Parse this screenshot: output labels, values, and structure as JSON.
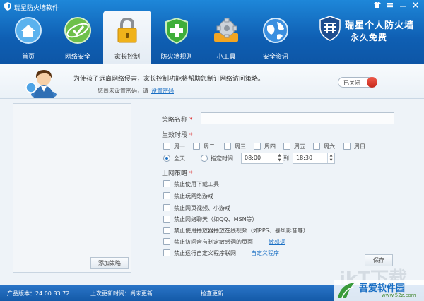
{
  "window": {
    "title": "瑞星防火墙软件"
  },
  "brand": {
    "line1": "瑞星个人防火墙",
    "line2": "永久免费"
  },
  "nav": [
    {
      "label": "首页",
      "icon": "home-icon"
    },
    {
      "label": "网络安全",
      "icon": "network-security-icon"
    },
    {
      "label": "家长控制",
      "icon": "lock-icon",
      "active": true
    },
    {
      "label": "防火墙规则",
      "icon": "shield-icon"
    },
    {
      "label": "小工具",
      "icon": "gear-icon"
    },
    {
      "label": "安全资讯",
      "icon": "globe-icon"
    }
  ],
  "header": {
    "message": "为使孩子远离网络侵害，家长控制功能将帮助您制订网络访问策略。",
    "sub_prefix": "您尚未设置密码，请",
    "sub_link": "设置密码",
    "toggle_label": "已关闭",
    "toggle_on": false
  },
  "left": {
    "add_button": "添加策略"
  },
  "form": {
    "name_label": "策略名称",
    "name_value": "",
    "period_label": "生效时段",
    "days": [
      "周一",
      "周二",
      "周三",
      "周四",
      "周五",
      "周六",
      "周日"
    ],
    "all_day": "全天",
    "custom_time": "指定时间",
    "time_start": "08:00",
    "time_to": "到",
    "time_end": "18:30",
    "policy_label": "上网策略",
    "policies": [
      "禁止使用下载工具",
      "禁止玩网络游戏",
      "禁止网页视频、小游戏",
      "禁止网络聊天（如QQ、MSN等）",
      "禁止使用播放器播放在线视频（如PPS、暴风影音等）",
      "禁止访问含有制定敏感词的页面",
      "禁止运行自定义程序联网"
    ],
    "sensitive_link": "敏感词",
    "custom_prog_link": "自定义程序",
    "save_button": "保存"
  },
  "status": {
    "version": "产品版本：24.00.33.72",
    "last_update": "上次更新时间：尚未更新",
    "check_update": "检查更新"
  },
  "watermark": {
    "big": "ikT下载",
    "name": "吾爱软件园",
    "url": "www.52z.com"
  },
  "colors": {
    "accent": "#1a6fc4",
    "toolbar": "#0f5fb3",
    "danger": "#d33"
  }
}
